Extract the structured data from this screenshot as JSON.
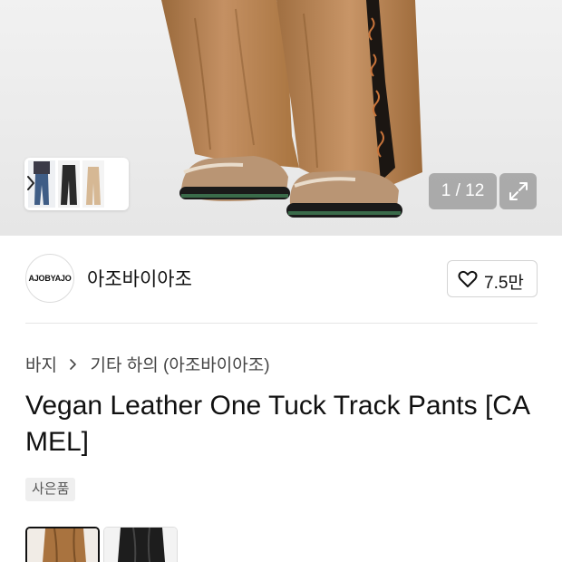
{
  "gallery": {
    "counter": "1 / 12",
    "thumbs_chevron_icon": "chevron-right-icon",
    "expand_icon": "expand-icon"
  },
  "brand": {
    "logo_text": "AJOBYAJO",
    "name": "아조바이아조",
    "like_icon": "heart-outline-icon",
    "like_count": "7.5만"
  },
  "breadcrumb": {
    "items": [
      "바지",
      "기타 하의 (아조바이아조)"
    ],
    "separator_icon": "chevron-right-icon"
  },
  "product": {
    "title": "Vegan Leather One Tuck Track Pants [CAMEL]",
    "badge": "사은품"
  },
  "color_options": [
    {
      "name": "camel",
      "selected": true,
      "swatch": "#a9733f"
    },
    {
      "name": "black",
      "selected": false,
      "swatch": "#1d1d1d"
    }
  ],
  "colors": {
    "text": "#111111",
    "muted": "#444444",
    "overlay": "#969696",
    "camel": "#b08155"
  }
}
